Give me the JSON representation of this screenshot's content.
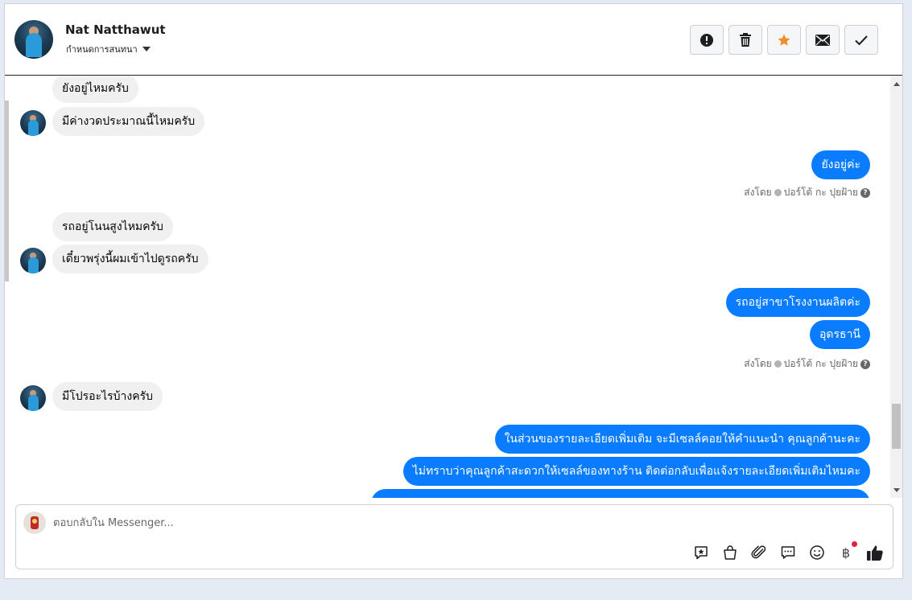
{
  "header": {
    "name": "Nat Natthawut",
    "subtitle": "กำหนดการสนทนา",
    "actions": [
      {
        "id": "report",
        "icon": "exclamation-circle-icon"
      },
      {
        "id": "delete",
        "icon": "trash-icon"
      },
      {
        "id": "star",
        "icon": "star-icon"
      },
      {
        "id": "mail",
        "icon": "envelope-icon"
      },
      {
        "id": "done",
        "icon": "check-icon"
      }
    ],
    "accent_star": "#f28c28"
  },
  "messages": [
    {
      "side": "in",
      "text": "ยังอยู่ไหมครับ"
    },
    {
      "side": "in",
      "text": "มีค่างวดประมาณนี้ไหมครับ"
    },
    {
      "side": "out",
      "text": "ยังอยู่ค่ะ"
    },
    {
      "side": "in",
      "text": "รถอยู่โนนสูงไหมครับ"
    },
    {
      "side": "in",
      "text": "เดี๋ยวพรุ่งนี้ผมเข้าไปดูรถครับ"
    },
    {
      "side": "out",
      "text": "รถอยู่สาขาโรงงานผลิตค่ะ"
    },
    {
      "side": "out",
      "text": "อุดรธานี"
    },
    {
      "side": "in",
      "text": "มีโปรอะไรบ้างครับ"
    },
    {
      "side": "out",
      "text": "ในส่วนของรายละเอียดเพิ่มเติม จะมีเซลล์คอยให้คำแนะนำ คุณลูกค้านะคะ"
    },
    {
      "side": "out",
      "text": "ไม่ทราบว่าคุณลูกค้าสะดวกให้เซลล์ของทางร้าน ติดต่อกลับเพื่อแจ้งรายละเอียดเพิ่มเติมไหมคะ"
    }
  ],
  "sent_by": {
    "prefix": "ส่งโดย",
    "agent": "ปอร์โต้ กะ ปุยฝ้าย"
  },
  "composer": {
    "placeholder": "ตอบกลับใน Messenger...",
    "baht_symbol": "฿",
    "tools": [
      "saved-reply-icon",
      "shop-bag-icon",
      "paperclip-icon",
      "chat-bubble-icon",
      "emoji-icon",
      "baht-icon",
      "thumbs-up-icon"
    ]
  },
  "colors": {
    "outgoing_bubble": "#0a7cff",
    "incoming_bubble": "#f0f0f0"
  }
}
